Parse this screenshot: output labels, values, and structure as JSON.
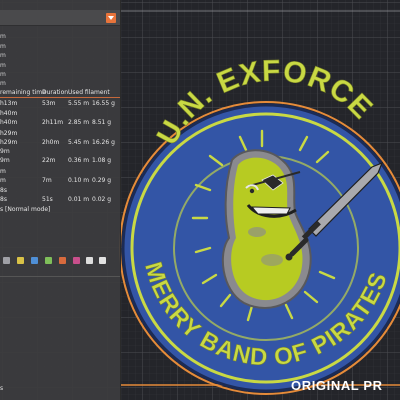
{
  "left_panel": {
    "header_rows": [
      "m",
      "m",
      "m",
      "m",
      "m",
      "m"
    ],
    "columns": {
      "remaining_label": "remaining time",
      "duration_label": "Duration",
      "filament_label": "Used filament"
    },
    "rows": [
      {
        "remaining": "h13m",
        "duration": "53m",
        "length": "5.55 m",
        "weight": "16.55 g"
      },
      {
        "remaining": "h40m",
        "duration": "",
        "length": "",
        "weight": ""
      },
      {
        "remaining": "h40m",
        "duration": "2h11m",
        "length": "2.85 m",
        "weight": "8.51 g"
      },
      {
        "remaining": "h29m",
        "duration": "",
        "length": "",
        "weight": ""
      },
      {
        "remaining": "h29m",
        "duration": "2h0m",
        "length": "5.45 m",
        "weight": "16.26 g"
      },
      {
        "remaining": "9m",
        "duration": "",
        "length": "",
        "weight": ""
      },
      {
        "remaining": "9m",
        "duration": "22m",
        "length": "0.36 m",
        "weight": "1.08 g"
      },
      {
        "remaining": "m",
        "duration": "",
        "length": "",
        "weight": ""
      },
      {
        "remaining": "m",
        "duration": "7m",
        "length": "0.10 m",
        "weight": "0.29 g"
      },
      {
        "remaining": "8s",
        "duration": "",
        "length": "",
        "weight": ""
      },
      {
        "remaining": "8s",
        "duration": "51s",
        "length": "0.01 m",
        "weight": "0.02 g"
      }
    ],
    "mode_note": "s [Normal mode]",
    "bottom_left": "s"
  },
  "viewport": {
    "badge_top_text": "U.N. EXFORCE",
    "badge_bottom_text": "MERRY BAND OF PIRATES",
    "overlay_label": "ORIGINAL PR",
    "colors": {
      "badge_blue": "#3355a6",
      "badge_yellow": "#c9d944",
      "badge_gray": "#8a8a8f",
      "rim_orange": "#e58b3a",
      "bed_grid": "#4a4b50"
    }
  }
}
